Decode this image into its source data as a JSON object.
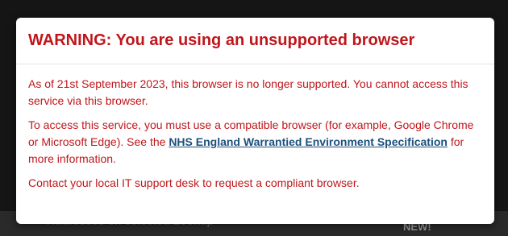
{
  "background": {
    "left_text": "Addresses on selected Lookup",
    "right_text": "NEW!"
  },
  "modal": {
    "title": "WARNING: You are using an unsupported browser",
    "paragraph1": "As of 21st September 2023, this browser is no longer supported. You cannot access this service via this browser.",
    "paragraph2_before": "To access this service, you must use a compatible browser (for example, Google Chrome or Microsoft Edge). See the ",
    "paragraph2_link": "NHS England Warrantied Environment Specification",
    "paragraph2_after": " for more information.",
    "paragraph3": "Contact your local IT support desk to request a compliant browser."
  },
  "colors": {
    "warning_red": "#c0161b",
    "link_blue": "#1d4f7d"
  }
}
